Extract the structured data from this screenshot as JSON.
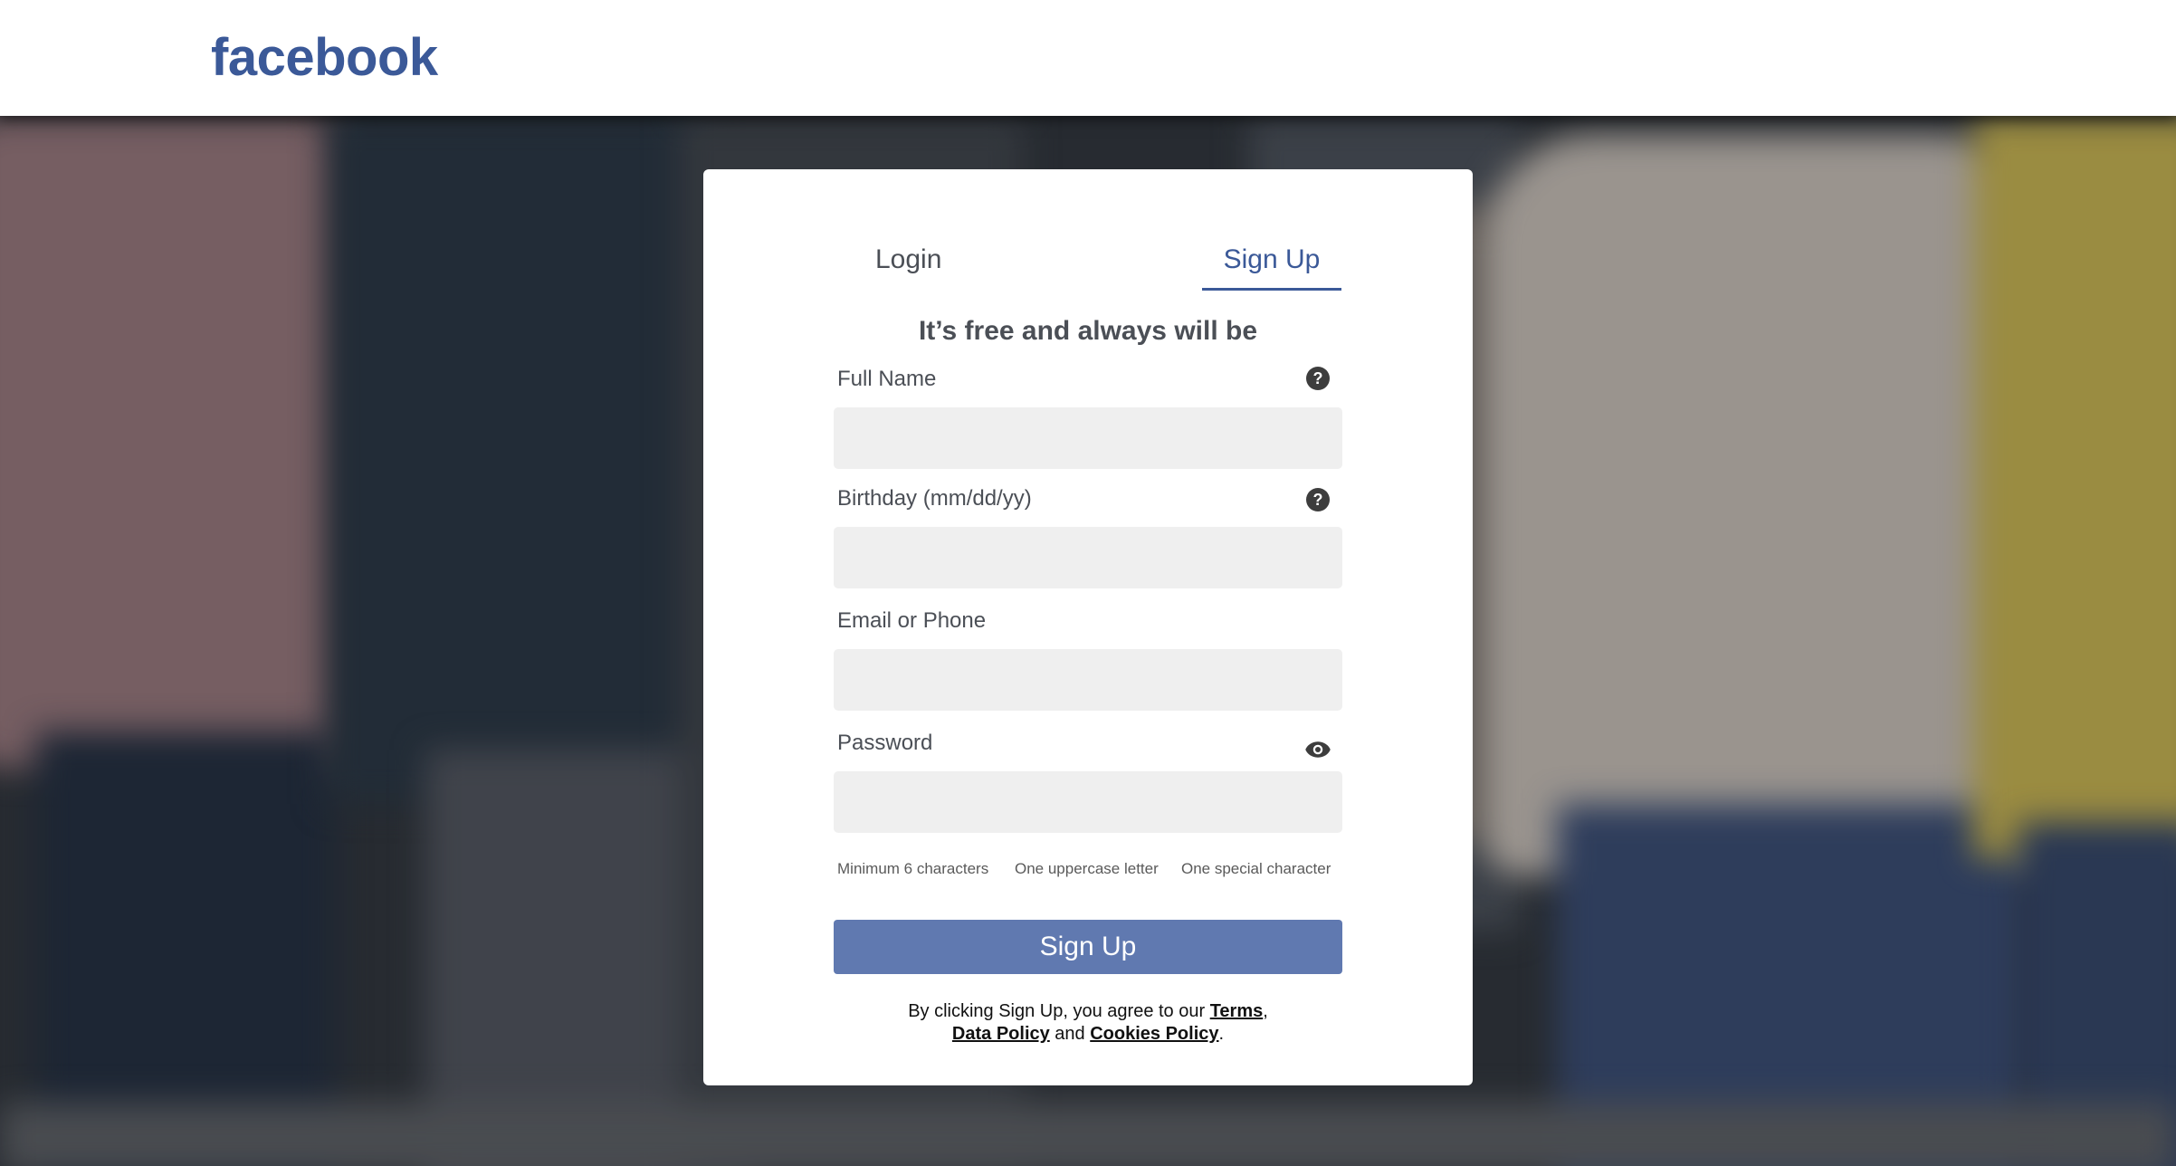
{
  "header": {
    "logo_text": "facebook",
    "brand_color": "#3b5998"
  },
  "card": {
    "tabs": [
      {
        "label": "Login",
        "active": false
      },
      {
        "label": "Sign Up",
        "active": true
      }
    ],
    "tagline": "It’s free and always will be",
    "fields": {
      "full_name": {
        "label": "Full Name",
        "value": "",
        "icon": "help-icon"
      },
      "birthday": {
        "label": "Birthday (mm/dd/yy)",
        "value": "",
        "icon": "help-icon"
      },
      "email_phone": {
        "label": "Email or Phone",
        "value": ""
      },
      "password": {
        "label": "Password",
        "value": "",
        "icon": "eye-icon"
      }
    },
    "help_glyph": "?",
    "password_rules": [
      "Minimum 6 characters",
      "One uppercase letter",
      "One special character"
    ],
    "submit_label": "Sign Up",
    "submit_color": "#6079b0",
    "legal": {
      "prefix": "By clicking Sign Up, you agree to our ",
      "terms": "Terms",
      "comma": ",",
      "data_policy": "Data Policy",
      "and": " and ",
      "cookies_policy": "Cookies Policy",
      "period": "."
    }
  }
}
